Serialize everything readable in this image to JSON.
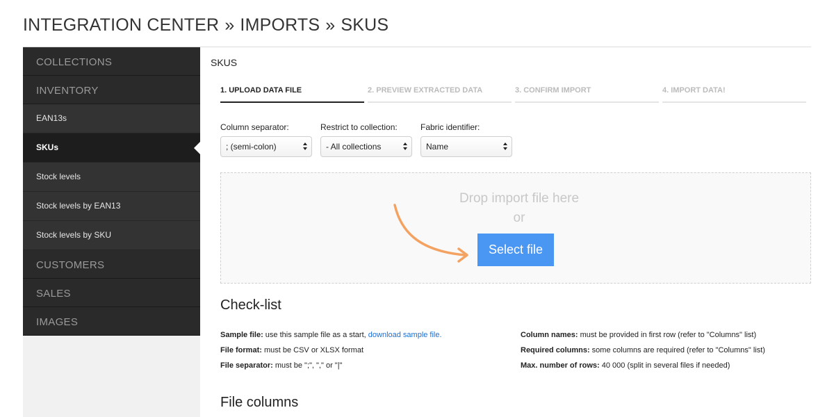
{
  "breadcrumb": [
    "INTEGRATION CENTER",
    "IMPORTS",
    "SKUS"
  ],
  "breadcrumb_separator": "»",
  "sidebar": {
    "sections": [
      {
        "label": "COLLECTIONS"
      },
      {
        "label": "INVENTORY",
        "items": [
          "EAN13s",
          "SKUs",
          "Stock levels",
          "Stock levels by EAN13",
          "Stock levels by SKU"
        ]
      },
      {
        "label": "CUSTOMERS"
      },
      {
        "label": "SALES"
      },
      {
        "label": "IMAGES"
      }
    ],
    "active_item": "SKUs"
  },
  "main": {
    "title": "SKUS",
    "steps": [
      {
        "label": "1. UPLOAD DATA FILE",
        "active": true
      },
      {
        "label": "2. PREVIEW EXTRACTED DATA",
        "active": false
      },
      {
        "label": "3. CONFIRM IMPORT",
        "active": false
      },
      {
        "label": "4. IMPORT DATA!",
        "active": false
      }
    ],
    "fields": [
      {
        "label": "Column separator:",
        "value": "; (semi-colon)"
      },
      {
        "label": "Restrict to collection:",
        "value": "- All collections"
      },
      {
        "label": "Fabric identifier:",
        "value": "Name"
      }
    ],
    "dropzone": {
      "text": "Drop import file here",
      "or": "or",
      "button": "Select file",
      "arrow_color": "#f4a261"
    },
    "checklist": {
      "title": "Check-list",
      "left": [
        {
          "label": "Sample file:",
          "text": " use this sample file as a start, ",
          "link": "download sample file."
        },
        {
          "label": "File format:",
          "text": " must be CSV or XLSX format"
        },
        {
          "label": "File separator:",
          "text": " must be \";\", \",\" or \"|\""
        }
      ],
      "right": [
        {
          "label": "Column names:",
          "text": " must be provided in first row (refer to \"Columns\" list)"
        },
        {
          "label": "Required columns:",
          "text": " some columns are required (refer to \"Columns\" list)"
        },
        {
          "label": "Max. number of rows:",
          "text": " 40 000 (split in several files if needed)"
        }
      ]
    },
    "file_columns_title": "File columns"
  },
  "colors": {
    "accent": "#4a96f3",
    "sidebar_bg": "#262626",
    "link": "#1a6fd6"
  }
}
